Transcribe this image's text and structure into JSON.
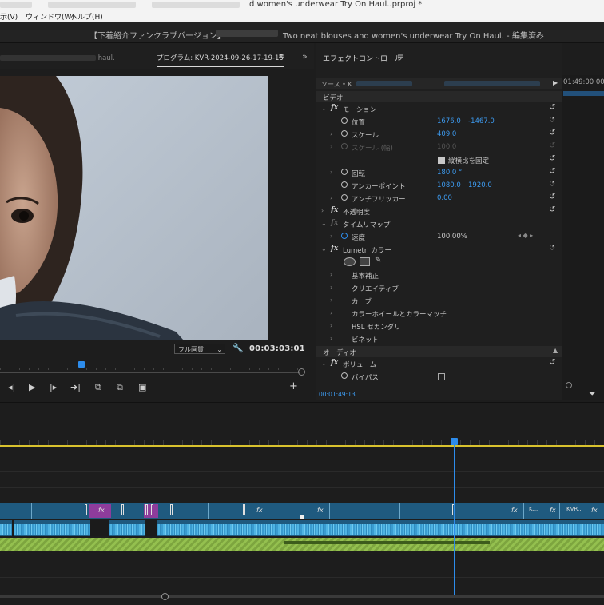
{
  "menubar": {
    "items": [
      "示(V)",
      "ウィンドウ(W)",
      "ヘルプ(H)"
    ],
    "project_title": "d women's underwear Try On Haul..prproj *"
  },
  "app_title": {
    "prefix": "【下着紹介ファンクラブバージョン】",
    "suffix": "Two neat blouses and women's underwear Try On Haul. - 編集済み"
  },
  "monitor": {
    "source_tab": "haul.",
    "program_tab": "プログラム: KVR-2024-09-26-17-19-15",
    "menu_glyph": "≡",
    "panel_arrows": "»",
    "quality": "フル画質",
    "timecode": "00:03:03:01",
    "playhead_fraction": 0.27
  },
  "effect_controls": {
    "title": "エフェクトコントロール",
    "menu_glyph": "≡",
    "source_label": "ソース • K",
    "video_section": "ビデオ",
    "motion": "モーション",
    "position": {
      "label": "位置",
      "x": "1676.0",
      "y": "-1467.0"
    },
    "scale": {
      "label": "スケール",
      "value": "409.0"
    },
    "scale_width": {
      "label": "スケール (幅)",
      "value": "100.0"
    },
    "uniform_scale": "縦横比を固定",
    "rotation": {
      "label": "回転",
      "value": "180.0 °"
    },
    "anchor": {
      "label": "アンカーポイント",
      "x": "1080.0",
      "y": "1920.0"
    },
    "antiflicker": {
      "label": "アンチフリッカー",
      "value": "0.00"
    },
    "opacity": "不透明度",
    "time_remap": "タイムリマップ",
    "speed": {
      "label": "速度",
      "value": "100.00%"
    },
    "lumetri": "Lumetri カラー",
    "lumetri_items": [
      "基本補正",
      "クリエイティブ",
      "カーブ",
      "カラーホイールとカラーマッチ",
      "HSL セカンダリ",
      "ビネット"
    ],
    "audio_section": "オーディオ",
    "volume": "ボリューム",
    "bypass": "バイパス",
    "bottom_timecode": "00:01:49:13"
  },
  "mini_timeline": {
    "timecode": "01:49:00 00"
  },
  "timeline": {
    "clip_labels": [
      "fx",
      "fx",
      "fx",
      "fx",
      "fx",
      "K...",
      "fx",
      "KVR...",
      "fx"
    ]
  },
  "colors": {
    "accent_blue": "#2d8ceb",
    "clip_blue": "#1f5a7f",
    "audio_green": "#94c04f",
    "clip_purple": "#8e3c9c",
    "workarea_yellow": "#d9c22e"
  }
}
